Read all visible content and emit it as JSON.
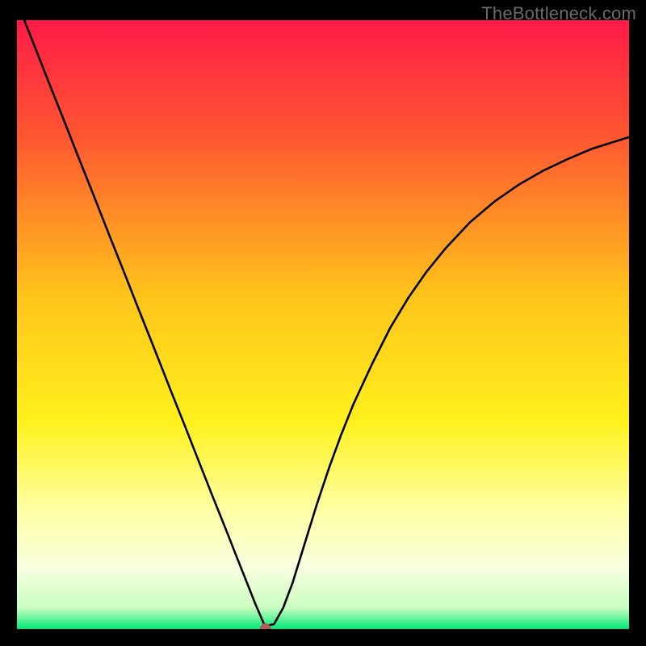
{
  "watermark": "TheBottleneck.com",
  "chart_data": {
    "type": "line",
    "title": "",
    "xlabel": "",
    "ylabel": "",
    "xlim": [
      0,
      100
    ],
    "ylim": [
      0,
      100
    ],
    "grid": false,
    "legend": false,
    "gradient_stops": [
      {
        "offset": 0.0,
        "color": "#ff1a48"
      },
      {
        "offset": 0.2,
        "color": "#ff5a30"
      },
      {
        "offset": 0.45,
        "color": "#ffc31a"
      },
      {
        "offset": 0.66,
        "color": "#fff11d"
      },
      {
        "offset": 0.8,
        "color": "#ffffa0"
      },
      {
        "offset": 0.9,
        "color": "#f8ffe0"
      },
      {
        "offset": 0.965,
        "color": "#caffc0"
      },
      {
        "offset": 1.0,
        "color": "#00e878"
      }
    ],
    "series": [
      {
        "name": "bottleneck-curve",
        "x": [
          0.0,
          2.5,
          5.0,
          7.5,
          10.0,
          12.5,
          15.0,
          17.5,
          20.0,
          22.5,
          25.0,
          27.5,
          30.0,
          32.0,
          34.0,
          36.0,
          37.5,
          39.0,
          40.5,
          42.0,
          43.5,
          45.0,
          47.0,
          49.0,
          51.0,
          53.0,
          55.0,
          58.0,
          61.0,
          64.0,
          67.0,
          70.0,
          74.0,
          78.0,
          82.0,
          86.0,
          90.0,
          94.0,
          100.0
        ],
        "values": [
          103.0,
          96.7,
          90.3,
          84.0,
          77.6,
          71.3,
          64.9,
          58.6,
          52.2,
          45.9,
          39.5,
          33.2,
          26.8,
          21.7,
          16.7,
          11.6,
          7.8,
          4.0,
          0.5,
          0.8,
          3.5,
          7.5,
          14.0,
          20.5,
          26.5,
          32.0,
          37.0,
          43.5,
          49.5,
          54.5,
          58.8,
          62.5,
          66.8,
          70.2,
          73.0,
          75.3,
          77.2,
          78.9,
          80.8
        ]
      }
    ],
    "marker": {
      "x": 40.6,
      "y": 0.0,
      "label": "minimum-point",
      "color": "#b45a5a",
      "radius_px": 7
    }
  }
}
